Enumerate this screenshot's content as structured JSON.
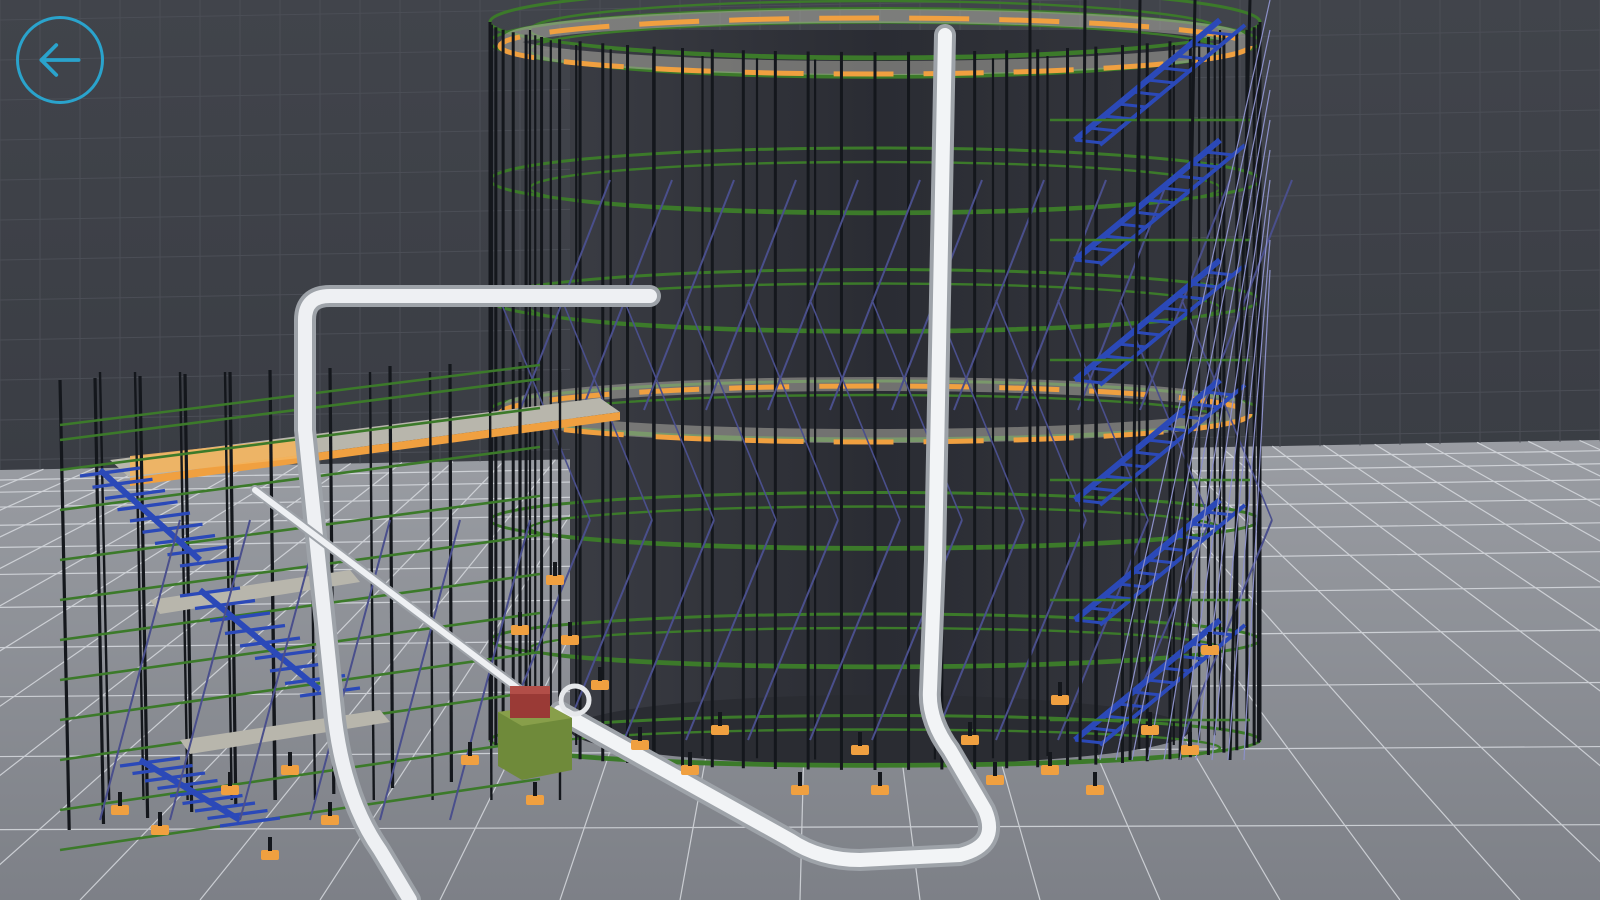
{
  "app": {
    "back_button_label": "",
    "back_icon": "arrow-left-icon"
  },
  "colors": {
    "accent": "#2aa3cc",
    "wall": "#3f424a",
    "floor": "#8c8f96",
    "grid": "#dfe2e6",
    "scaffold_tube": "#14171c",
    "ledger": "#3c7a2a",
    "brace": "#4a4f8c",
    "stair": "#2b49b8",
    "deck": "#b8b6ac",
    "toe_board": "#f0a040",
    "pipe": "#e9ecef",
    "tank": "#2f3138",
    "valve_red": "#9a3a36",
    "valve_box": "#6f8a3a"
  }
}
